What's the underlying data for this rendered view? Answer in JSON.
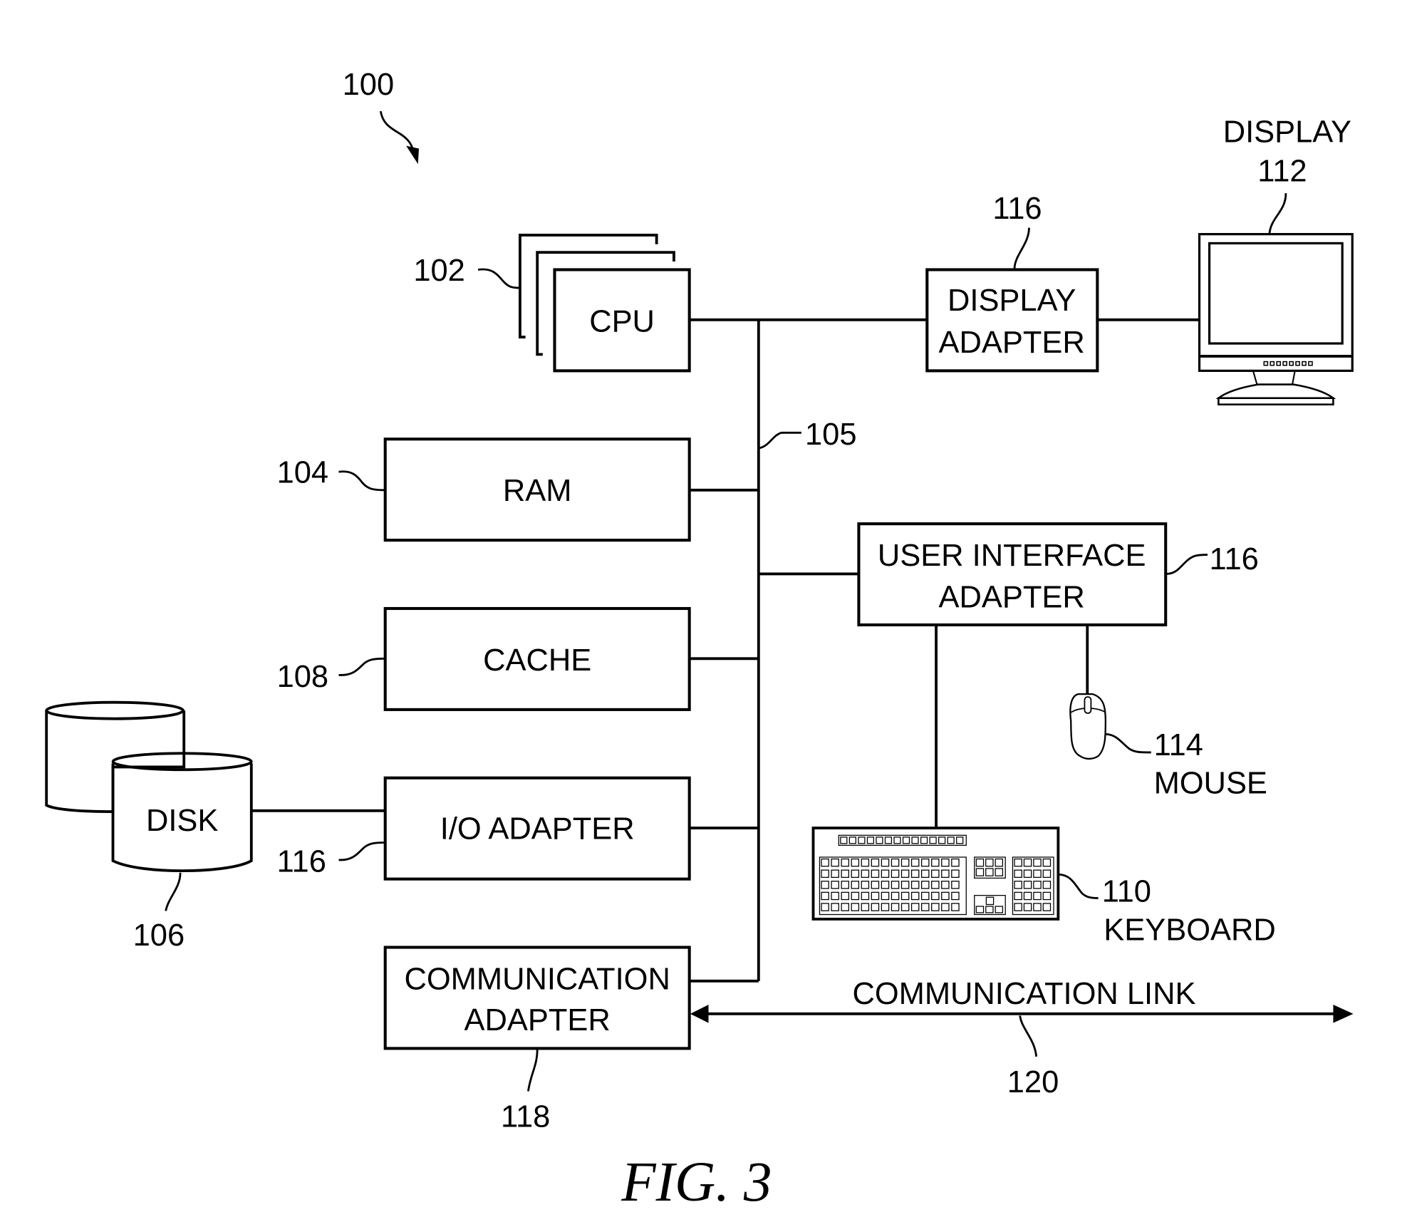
{
  "figure": {
    "title": "FIG. 3",
    "system_ref": "100"
  },
  "bus": {
    "ref": "105"
  },
  "components": {
    "cpu": {
      "label": "CPU",
      "ref": "102"
    },
    "ram": {
      "label": "RAM",
      "ref": "104"
    },
    "cache": {
      "label": "CACHE",
      "ref": "108"
    },
    "io_adapter": {
      "label": "I/O ADAPTER",
      "ref": "116"
    },
    "comm_adapter": {
      "line1": "COMMUNICATION",
      "line2": "ADAPTER",
      "ref": "118"
    },
    "display_adapter": {
      "line1": "DISPLAY",
      "line2": "ADAPTER",
      "ref": "116"
    },
    "ui_adapter": {
      "line1": "USER INTERFACE",
      "line2": "ADAPTER",
      "ref": "116"
    },
    "disk": {
      "label": "DISK",
      "ref": "106"
    },
    "display": {
      "label": "DISPLAY",
      "ref": "112"
    },
    "mouse": {
      "label": "MOUSE",
      "ref": "114"
    },
    "keyboard": {
      "label": "KEYBOARD",
      "ref": "110"
    },
    "comm_link": {
      "label": "COMMUNICATION LINK",
      "ref": "120"
    }
  }
}
